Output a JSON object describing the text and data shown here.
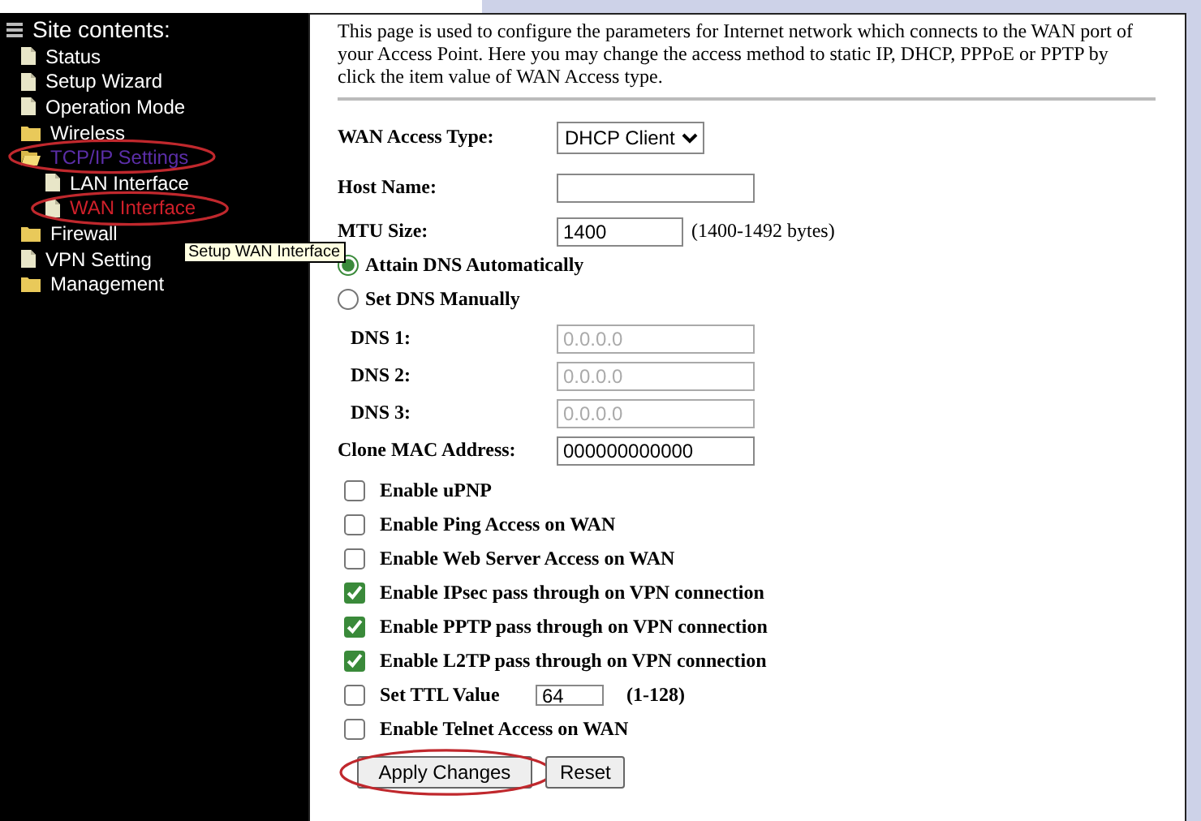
{
  "sidebar": {
    "title": "Site contents:",
    "items": [
      {
        "label": "Status",
        "kind": "page",
        "selected": false,
        "circled": false
      },
      {
        "label": "Setup Wizard",
        "kind": "page",
        "selected": false,
        "circled": false
      },
      {
        "label": "Operation Mode",
        "kind": "page",
        "selected": false,
        "circled": false
      },
      {
        "label": "Wireless",
        "kind": "folder",
        "expanded": false,
        "selected": false,
        "circled": false
      },
      {
        "label": "TCP/IP Settings",
        "kind": "folder",
        "expanded": true,
        "selected": false,
        "circled": true,
        "children": [
          {
            "label": "LAN Interface",
            "kind": "page",
            "selected": false,
            "circled": false
          },
          {
            "label": "WAN Interface",
            "kind": "page",
            "selected": true,
            "circled": true
          }
        ]
      },
      {
        "label": "Firewall",
        "kind": "folder",
        "expanded": false,
        "selected": false,
        "circled": false
      },
      {
        "label": "VPN Setting",
        "kind": "page",
        "selected": false,
        "circled": false
      },
      {
        "label": "Management",
        "kind": "folder",
        "expanded": false,
        "selected": false,
        "circled": false
      }
    ]
  },
  "tooltip": "Setup WAN Interface",
  "intro": "This page is used to configure the parameters for Internet network which connects to the WAN port of your Access Point. Here you may change the access method to static IP, DHCP, PPPoE or PPTP by click the item value of WAN Access type.",
  "access_type": {
    "label": "WAN Access Type:",
    "value": "DHCP Client"
  },
  "fields": [
    {
      "label": "Host Name:"
    },
    {
      "label": "MTU Size:",
      "value": "1400",
      "hint": "(1400-1492 bytes)"
    }
  ],
  "dns_modes": [
    {
      "label": "Attain DNS Automatically",
      "selected": true
    },
    {
      "label": "Set DNS Manually",
      "selected": false
    }
  ],
  "dns_servers": [
    {
      "label": "DNS 1:",
      "value": "0.0.0.0",
      "disabled": true
    },
    {
      "label": "DNS 2:",
      "value": "0.0.0.0",
      "disabled": true
    },
    {
      "label": "DNS 3:",
      "value": "0.0.0.0",
      "disabled": true
    }
  ],
  "clone_mac": {
    "label": "Clone MAC Address:",
    "value": "000000000000"
  },
  "options": [
    {
      "label": "Enable uPNP",
      "checked": false
    },
    {
      "label": "Enable Ping Access on WAN",
      "checked": false
    },
    {
      "label": "Enable Web Server Access on WAN",
      "checked": false
    },
    {
      "label": "Enable IPsec pass through on VPN connection",
      "checked": true
    },
    {
      "label": "Enable PPTP pass through on VPN connection",
      "checked": true
    },
    {
      "label": "Enable L2TP pass through on VPN connection",
      "checked": true
    },
    {
      "label": "Set TTL Value",
      "checked": false,
      "value": "64",
      "hint": "(1-128)"
    },
    {
      "label": "Enable Telnet Access on WAN",
      "checked": false
    }
  ],
  "buttons": [
    {
      "label": "Apply Changes",
      "circled": true
    },
    {
      "label": "Reset",
      "circled": false
    }
  ]
}
